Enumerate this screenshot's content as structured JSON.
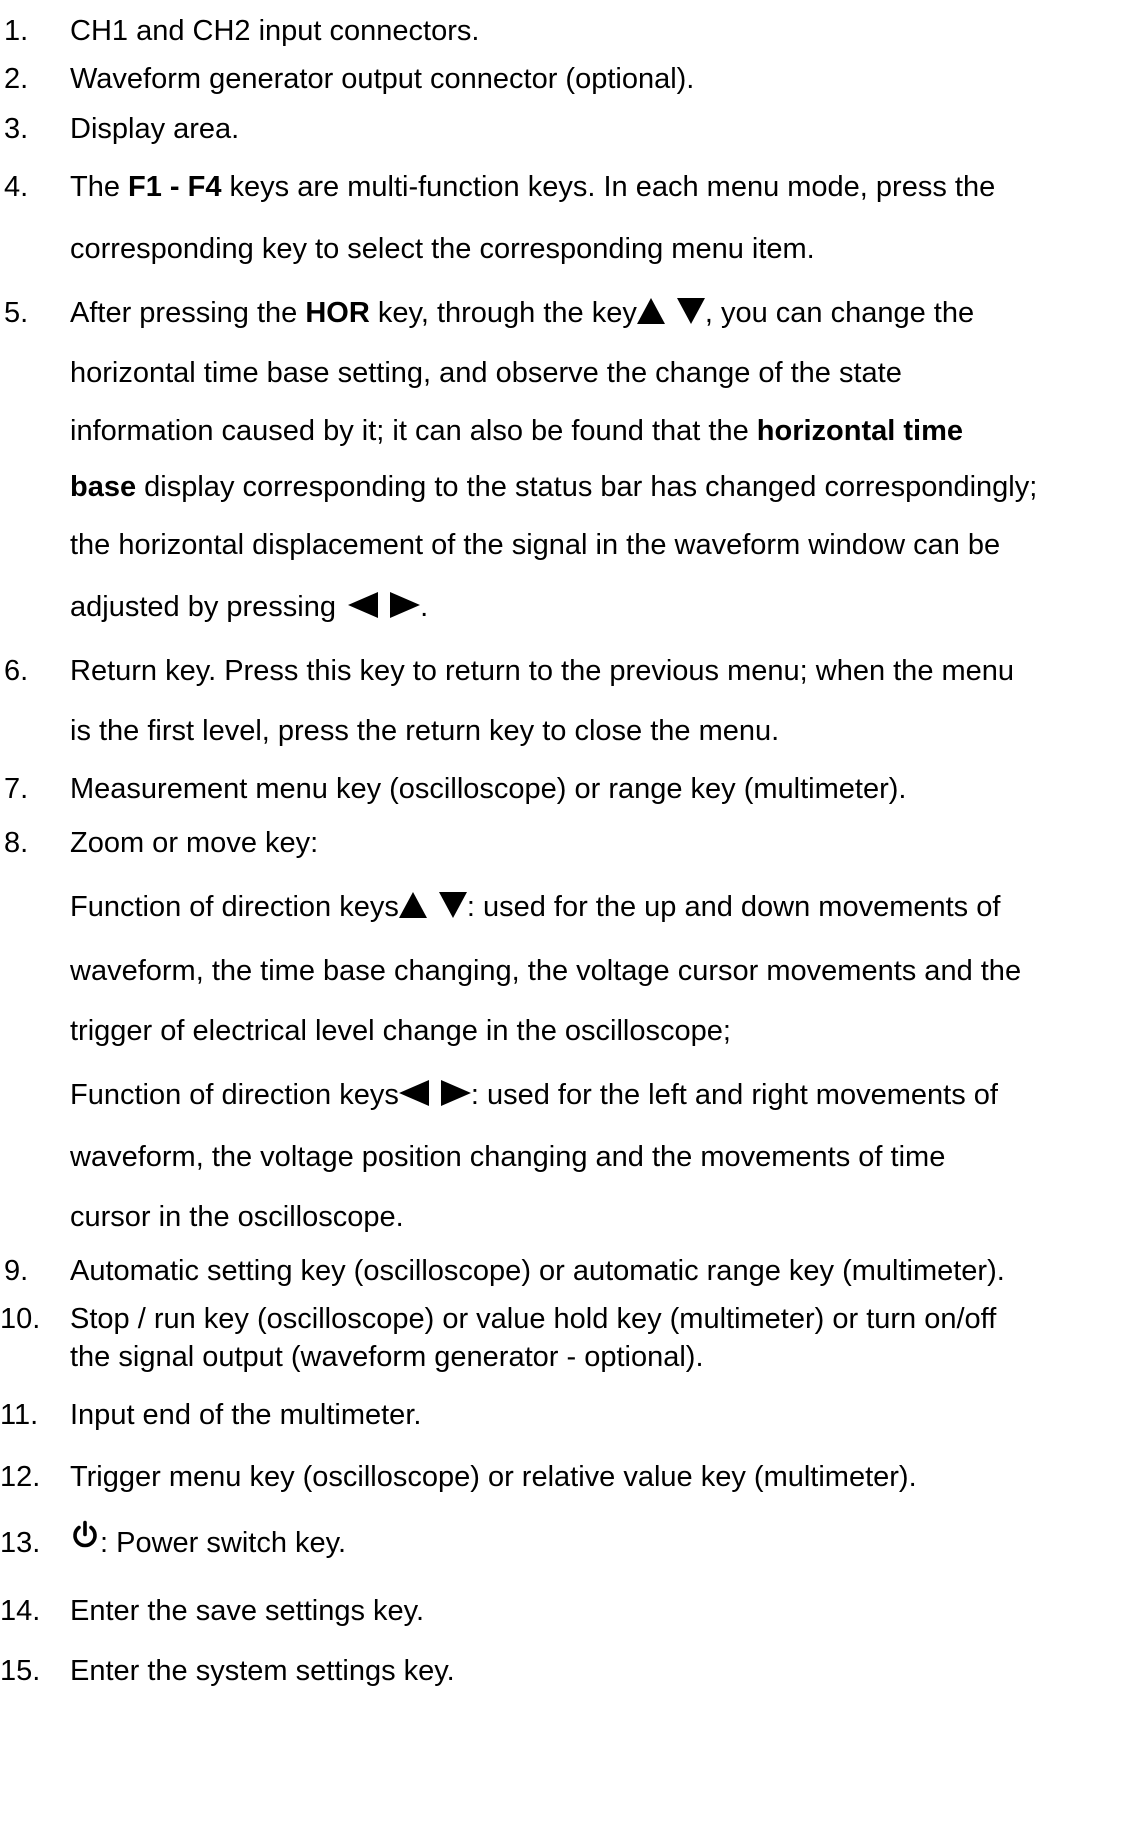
{
  "items": [
    {
      "num": "1.",
      "text": "CH1 and CH2 input connectors."
    },
    {
      "num": "2.",
      "text": "Waveform generator output connector (optional)."
    },
    {
      "num": "3.",
      "text": "Display area."
    },
    {
      "num": "4.",
      "pre": "The ",
      "bold": "F1 - F4",
      "post": " keys are multi-function keys. In each menu mode, press the",
      "line2": "corresponding key to select the corresponding menu item."
    },
    {
      "num": "5.",
      "l1_pre": "After pressing the ",
      "l1_bold": "HOR",
      "l1_mid": " key, through the key",
      "l1_post": ", you can change the",
      "l2": "horizontal time base setting, and observe the change of the state",
      "l3_pre": "information caused by it; it can also be found that the ",
      "l3_bold": "horizontal time",
      "l4_bold": "base",
      "l4_post": " display corresponding to the status bar has changed correspondingly;",
      "l5": "the horizontal displacement of the signal in the waveform window can be",
      "l6_pre": "adjusted by pressing ",
      "l6_post": "."
    },
    {
      "num": "6.",
      "line1": "Return key. Press this key to return to the previous menu; when the menu",
      "line2": "is the first level, press the return key to close the menu."
    },
    {
      "num": "7.",
      "text": "Measurement menu key (oscilloscope) or range key (multimeter)."
    },
    {
      "num": "8.",
      "title": "Zoom or move key:",
      "ud_pre": "Function of direction keys",
      "ud_post": ": used for the up and down movements of",
      "ud_l2": "waveform, the time base changing, the voltage cursor movements and the",
      "ud_l3": "trigger of electrical level change in the oscilloscope;",
      "lr_pre": "Function of direction keys",
      "lr_post": ": used for the left and right movements of",
      "lr_l2": "waveform, the voltage position changing and the movements of time",
      "lr_l3": "cursor in the oscilloscope."
    },
    {
      "num": "9.",
      "text": "Automatic setting key (oscilloscope) or automatic range key (multimeter)."
    },
    {
      "num": "10.",
      "line1": "Stop / run key (oscilloscope) or value hold key (multimeter) or turn on/off",
      "line2": "the signal output (waveform generator - optional)."
    },
    {
      "num": "11.",
      "text": "Input end of the multimeter."
    },
    {
      "num": "12.",
      "text": "Trigger menu key (oscilloscope) or relative value key (multimeter)."
    },
    {
      "num": "13.",
      "post": ": Power switch key."
    },
    {
      "num": "14.",
      "text": "Enter the save settings key."
    },
    {
      "num": "15.",
      "text": "Enter the system settings key."
    }
  ],
  "icons": {
    "up": "up-triangle-icon",
    "down": "down-triangle-icon",
    "left": "left-triangle-icon",
    "right": "right-triangle-icon",
    "power": "power-icon"
  }
}
